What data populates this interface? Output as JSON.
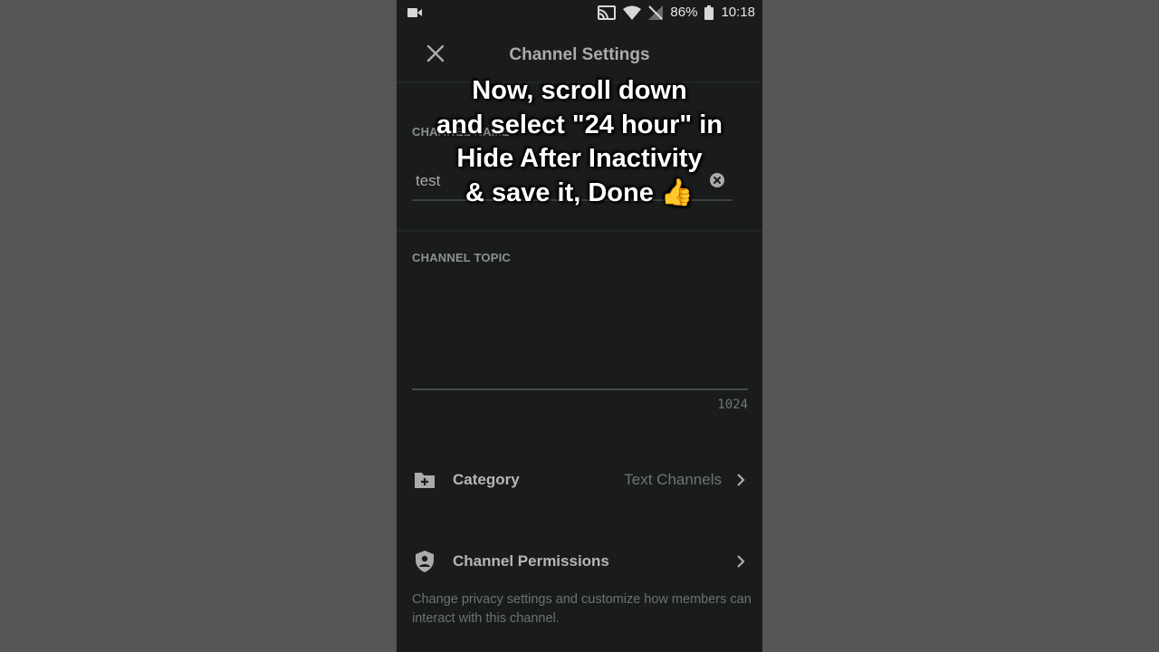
{
  "status_bar": {
    "battery": "86%",
    "time": "10:18"
  },
  "header": {
    "title": "Channel Settings"
  },
  "channel_name": {
    "label": "CHANNEL NAME",
    "value": "test"
  },
  "channel_topic": {
    "label": "CHANNEL TOPIC",
    "char_limit": "1024"
  },
  "category": {
    "label": "Category",
    "value": "Text Channels"
  },
  "permissions": {
    "label": "Channel Permissions",
    "description": "Change privacy settings and customize how members can interact with this channel."
  },
  "overlay_caption": {
    "line1": "Now, scroll down",
    "line2": "and select \"24 hour\" in",
    "line3": "Hide After Inactivity",
    "line4": "& save it, Done 👍"
  },
  "icons": {
    "camera": "video-camera-icon",
    "cast": "cast-icon",
    "wifi": "wifi-icon",
    "no_signal": "no-signal-icon",
    "battery": "battery-icon",
    "close": "close-icon",
    "clear": "clear-text-icon",
    "category": "folder-plus-icon",
    "permissions": "shield-person-icon",
    "chevron": "chevron-right-icon"
  },
  "colors": {
    "background": "#1a1c1c",
    "outer": "#555555",
    "text_primary": "#b4b7b6",
    "text_muted": "#6f7474"
  }
}
